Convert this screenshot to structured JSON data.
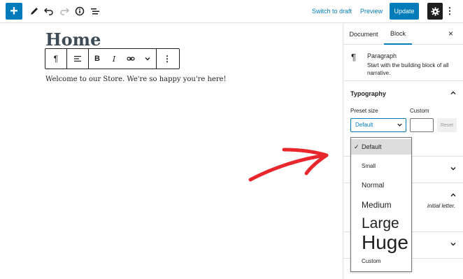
{
  "topbar": {
    "inserter_icon": "plus-icon",
    "tools": [
      "pencil-icon",
      "undo-icon",
      "redo-icon",
      "info-icon",
      "list-view-icon"
    ],
    "switch_to_draft": "Switch to draft",
    "preview": "Preview",
    "update": "Update",
    "settings_icon": "gear-icon",
    "more_icon": "vertical-ellipsis-icon"
  },
  "editor": {
    "title": "Home",
    "paragraph": "Welcome to our Store. We're so happy you're here!",
    "block_toolbar": {
      "paragraph_icon": "¶",
      "align_icon": "≡",
      "bold": "B",
      "italic": "I",
      "link_icon": "link-icon",
      "more_icon": "chevron-down-icon",
      "options_icon": "vertical-ellipsis-icon"
    }
  },
  "sidebar": {
    "tabs": [
      {
        "label": "Document"
      },
      {
        "label": "Block",
        "active": true
      }
    ],
    "close_icon": "×",
    "block_card": {
      "icon": "¶",
      "title": "Paragraph",
      "description": "Start with the building block of all narrative."
    },
    "typography": {
      "title": "Typography",
      "preset_label": "Preset size",
      "custom_label": "Custom",
      "selected": "Default",
      "reset": "Reset"
    },
    "drop_cap_note": "initial letter."
  },
  "dropdown": {
    "options": [
      {
        "label": "Default",
        "selected": true
      },
      {
        "label": "Small"
      },
      {
        "label": "Normal"
      },
      {
        "label": "Medium"
      },
      {
        "label": "Large"
      },
      {
        "label": "Huge"
      },
      {
        "label": "Custom"
      }
    ]
  },
  "colors": {
    "accent": "#007cba",
    "arrow": "#e8262b"
  }
}
